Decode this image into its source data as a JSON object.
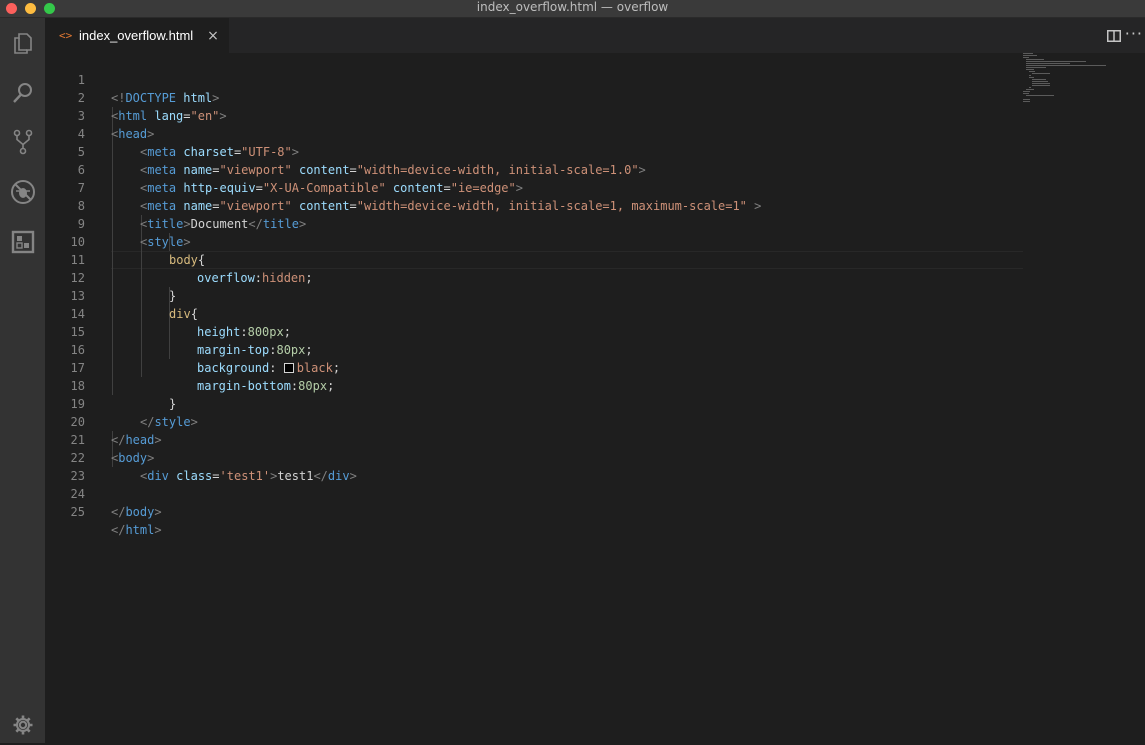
{
  "window": {
    "title": "index_overflow.html — overflow"
  },
  "activity_bar": {
    "icons": [
      "files-icon",
      "search-icon",
      "source-control-icon",
      "debug-icon",
      "extensions-icon",
      "gear-icon"
    ]
  },
  "tabs": [
    {
      "icon": "<>",
      "label": "index_overflow.html",
      "close": "×",
      "active": true
    }
  ],
  "toolbar": {
    "split": "split-editor-icon",
    "more": "···"
  },
  "editor": {
    "lines": [
      {
        "n": "1"
      },
      {
        "n": "2"
      },
      {
        "n": "3"
      },
      {
        "n": "4"
      },
      {
        "n": "5"
      },
      {
        "n": "6"
      },
      {
        "n": "7"
      },
      {
        "n": "8"
      },
      {
        "n": "9"
      },
      {
        "n": "10"
      },
      {
        "n": "11"
      },
      {
        "n": "12"
      },
      {
        "n": "13"
      },
      {
        "n": "14"
      },
      {
        "n": "15"
      },
      {
        "n": "16"
      },
      {
        "n": "17"
      },
      {
        "n": "18"
      },
      {
        "n": "19"
      },
      {
        "n": "20"
      },
      {
        "n": "21"
      },
      {
        "n": "22"
      },
      {
        "n": "23"
      },
      {
        "n": "24"
      },
      {
        "n": "25"
      }
    ],
    "tokens": {
      "l1": [
        "<!",
        "DOCTYPE",
        " html",
        ">"
      ],
      "l2": [
        "<",
        "html",
        " lang",
        "=",
        "\"en\"",
        ">"
      ],
      "l3": [
        "<",
        "head",
        ">"
      ],
      "l4": [
        "<",
        "meta",
        " charset",
        "=",
        "\"UTF-8\"",
        ">"
      ],
      "l5": [
        "<",
        "meta",
        " name",
        "=",
        "\"viewport\"",
        " content",
        "=",
        "\"width=device-width, initial-scale=1.0\"",
        ">"
      ],
      "l6": [
        "<",
        "meta",
        " http-equiv",
        "=",
        "\"X-UA-Compatible\"",
        " content",
        "=",
        "\"ie=edge\"",
        ">"
      ],
      "l7": [
        "<",
        "meta",
        " name",
        "=",
        "\"viewport\"",
        " content",
        "=",
        "\"width=device-width, initial-scale=1, maximum-scale=1\"",
        " >"
      ],
      "l8": [
        "<",
        "title",
        ">",
        "Document",
        "</",
        "title",
        ">"
      ],
      "l9": [
        "<",
        "style",
        ">"
      ],
      "l10": [
        "body",
        "{"
      ],
      "l11": [
        "overflow",
        ":",
        "hidden",
        ";"
      ],
      "l12": [
        "}"
      ],
      "l13": [
        "div",
        "{"
      ],
      "l14": [
        "height",
        ":",
        "800px",
        ";"
      ],
      "l15": [
        "margin-top",
        ":",
        "80px",
        ";"
      ],
      "l16": [
        "background",
        ": ",
        "black",
        ";"
      ],
      "l17": [
        "margin-bottom",
        ":",
        "80px",
        ";"
      ],
      "l18": [
        "}"
      ],
      "l19": [
        "</",
        "style",
        ">"
      ],
      "l20": [
        "</",
        "head",
        ">"
      ],
      "l21": [
        "<",
        "body",
        ">"
      ],
      "l22": [
        "<",
        "div",
        " class",
        "=",
        "'test1'",
        ">",
        "test1",
        "</",
        "div",
        ">"
      ],
      "l24": [
        "</",
        "body",
        ">"
      ],
      "l25": [
        "</",
        "html",
        ">"
      ]
    },
    "swatch_color": "#000000"
  },
  "colors": {
    "background": "#1e1e1e",
    "tag": "#569cd6",
    "attribute": "#9cdcfe",
    "string": "#ce9178",
    "selector": "#d7ba7d",
    "number": "#b5cea8",
    "line_number": "#858585",
    "tab_icon": "#e37933"
  }
}
